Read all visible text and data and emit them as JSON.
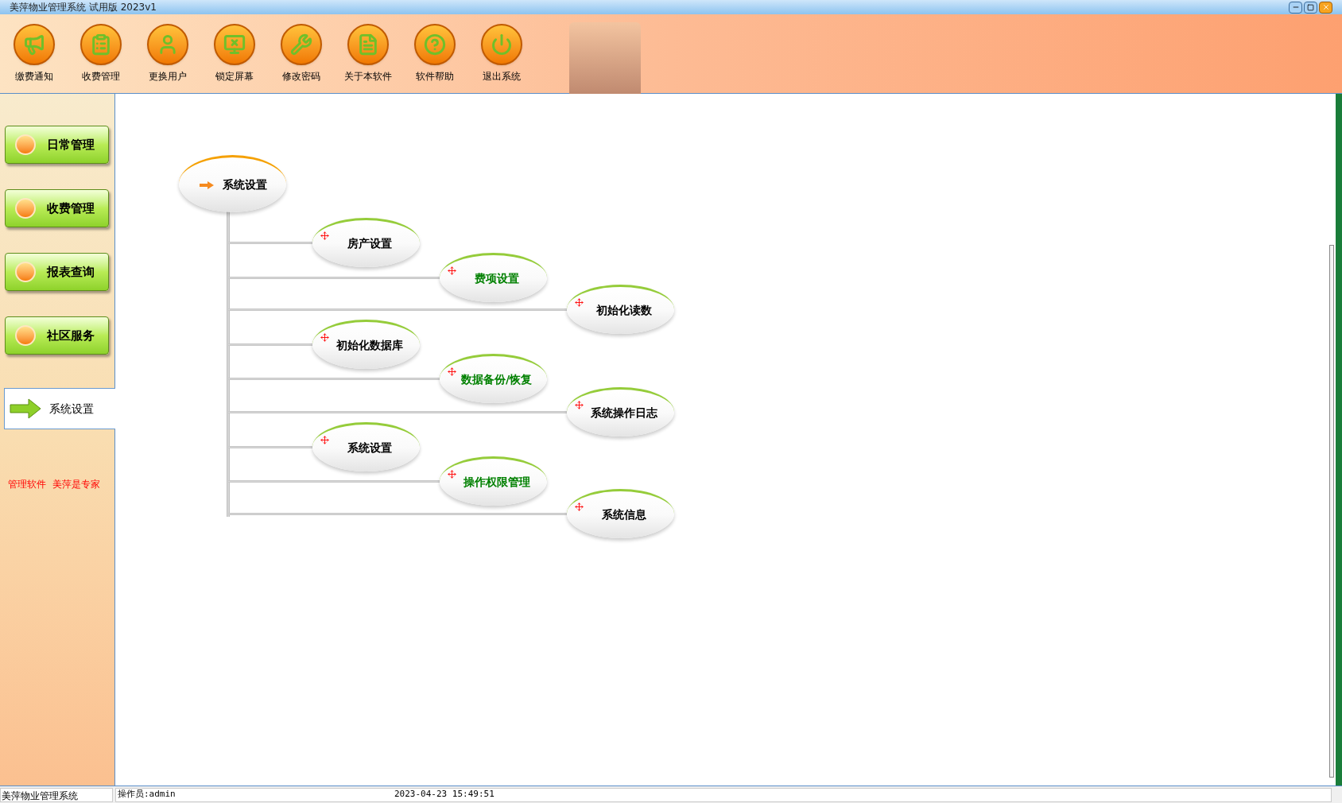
{
  "window": {
    "title": "美萍物业管理系统 试用版 2023v1"
  },
  "toolbar": [
    {
      "label": "缴费通知",
      "kind": "notice"
    },
    {
      "label": "收费管理",
      "kind": "billing"
    },
    {
      "label": "更换用户",
      "kind": "user"
    },
    {
      "label": "锁定屏幕",
      "kind": "lock"
    },
    {
      "label": "修改密码",
      "kind": "password"
    },
    {
      "label": "关于本软件",
      "kind": "about"
    },
    {
      "label": "软件帮助",
      "kind": "help"
    },
    {
      "label": "退出系统",
      "kind": "exit"
    }
  ],
  "sidebar": {
    "items": [
      {
        "label": "日常管理",
        "selected": false
      },
      {
        "label": "收费管理",
        "selected": false
      },
      {
        "label": "报表查询",
        "selected": false
      },
      {
        "label": "社区服务",
        "selected": false
      },
      {
        "label": "系统设置",
        "selected": true
      }
    ],
    "slogan": "管理软件  美萍是专家"
  },
  "diagram": {
    "root": "系统设置",
    "nodes": [
      {
        "label": "房产设置",
        "color": "#000000"
      },
      {
        "label": "费项设置",
        "color": "#008000"
      },
      {
        "label": "初始化读数",
        "color": "#000000"
      },
      {
        "label": "初始化数据库",
        "color": "#000000"
      },
      {
        "label": "数据备份/恢复",
        "color": "#008000"
      },
      {
        "label": "系统操作日志",
        "color": "#000000"
      },
      {
        "label": "系统设置",
        "color": "#000000"
      },
      {
        "label": "操作权限管理",
        "color": "#008000"
      },
      {
        "label": "系统信息",
        "color": "#000000"
      }
    ]
  },
  "status_bar": {
    "app": "美萍物业管理系统",
    "operator": "操作员:admin",
    "datetime": "2023-04-23 15:49:51"
  }
}
